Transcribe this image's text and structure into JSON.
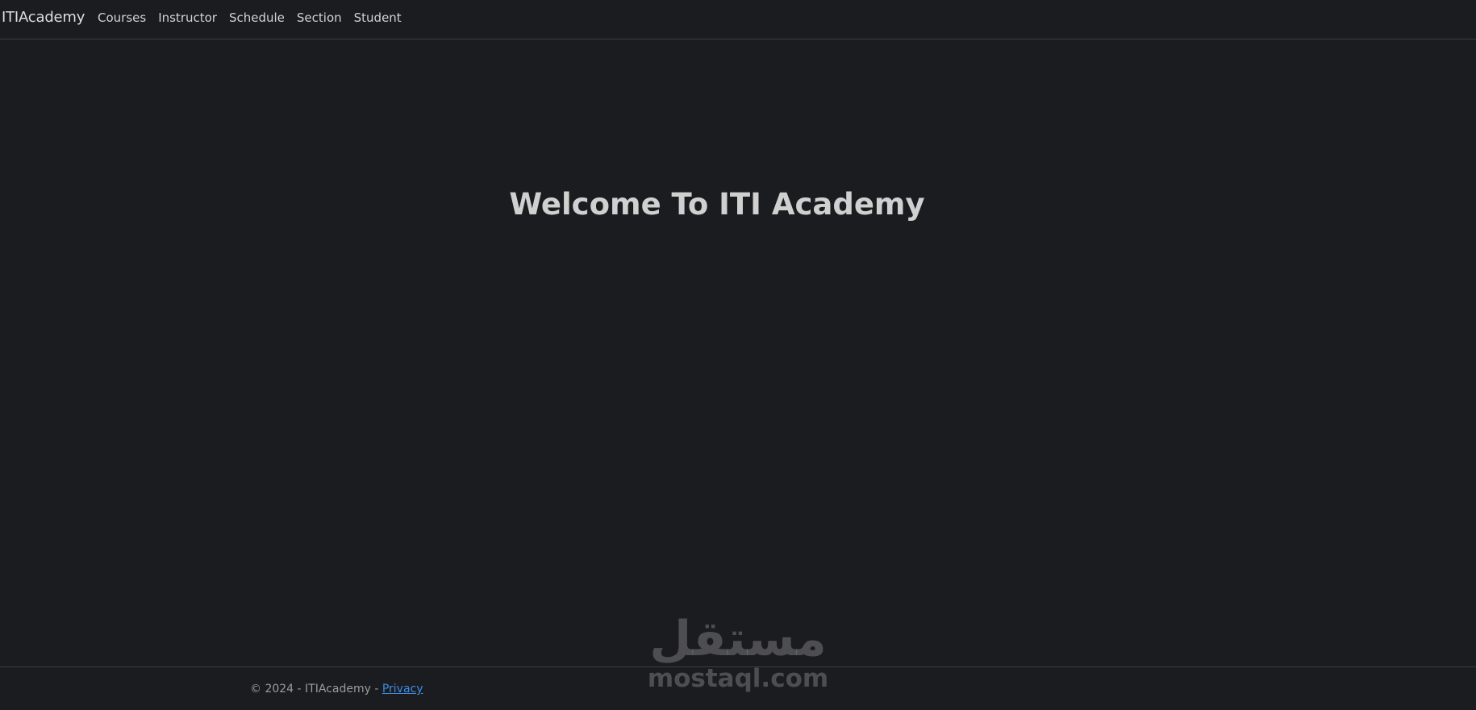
{
  "navbar": {
    "brand": "ITIAcademy",
    "links": [
      {
        "label": "Courses"
      },
      {
        "label": "Instructor"
      },
      {
        "label": "Schedule"
      },
      {
        "label": "Section"
      },
      {
        "label": "Student"
      }
    ]
  },
  "main": {
    "title": "Welcome To ITI Academy"
  },
  "footer": {
    "copyright": "© 2024 - ITIAcademy - ",
    "privacy_label": "Privacy"
  },
  "watermark": {
    "arabic": "مستقل",
    "latin": "mostaql.com"
  },
  "colors": {
    "background": "#1b1c1f",
    "link": "#3b8ee6"
  }
}
